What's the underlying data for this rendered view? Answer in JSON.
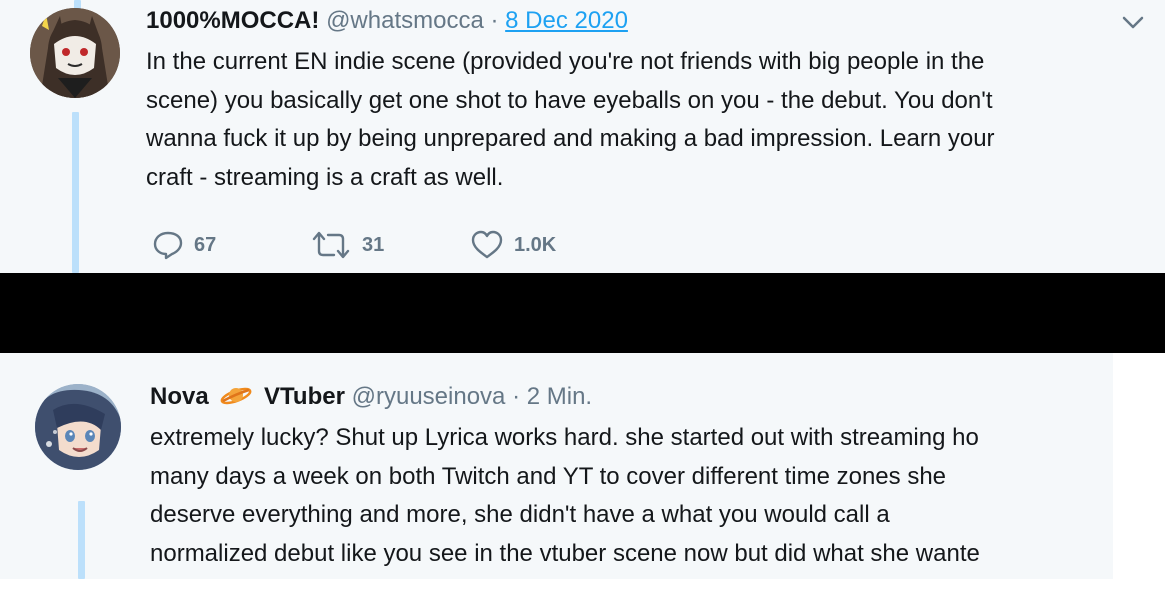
{
  "tweet1": {
    "display_name": "1000%MOCCA!",
    "handle": "@whatsmocca",
    "separator": "·",
    "date": "8 Dec 2020",
    "lines": [
      "In the current EN indie scene (provided you're not friends with big people in the",
      "scene) you basically get one shot to have eyeballs on you - the debut. You don't",
      "wanna fuck it up by being unprepared and making a bad impression. Learn your",
      "craft - streaming is a craft as well."
    ],
    "actions": {
      "replies": "67",
      "retweets": "31",
      "likes": "1.0K"
    },
    "icons": [
      "reply-icon",
      "retweet-icon",
      "like-icon",
      "chevron-down-icon"
    ]
  },
  "tweet2": {
    "display_name_start": "Nova",
    "emoji": "ringed-planet-emoji",
    "display_name_end": "VTuber",
    "handle": "@ryuuseinova",
    "separator": "·",
    "time": "2 Min.",
    "lines": [
      "extremely lucky? Shut up Lyrica works hard. she started out with streaming ho",
      "many days a week on both Twitch and YT to cover different time zones she",
      "deserve everything and more, she didn't have a what you would call a",
      "normalized debut like you see in the vtuber scene now but did what she wante"
    ]
  },
  "colors": {
    "panel_bg": "#f5f8fa",
    "accent": "#1da1f2",
    "secondary_text": "#657786",
    "thread_line": "#bce0fb",
    "redaction": "#000000"
  }
}
